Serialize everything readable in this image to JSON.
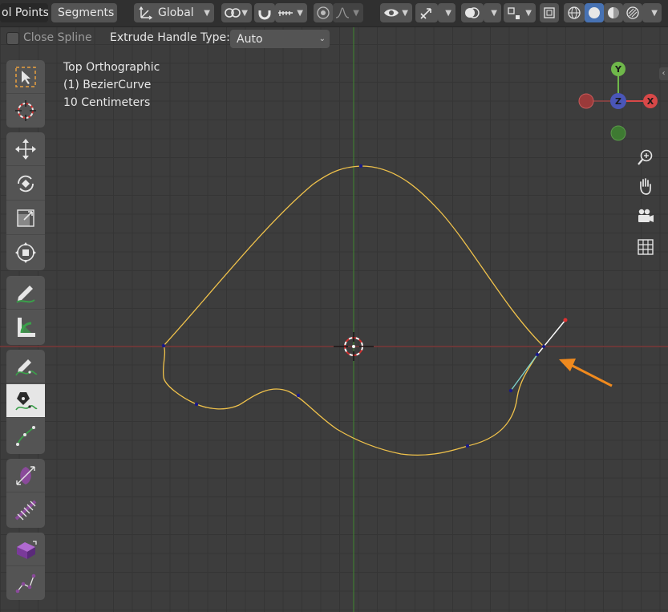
{
  "header": {
    "control_points_label": "ol Points",
    "segments_label": "Segments",
    "orientation_label": "Global"
  },
  "tool_settings": {
    "close_spline_label": "Close Spline",
    "extrude_handle_label": "Extrude Handle Type:",
    "extrude_handle_value": "Auto"
  },
  "viewport": {
    "view_name": "Top Orthographic",
    "object_name": "(1) BezierCurve",
    "scale": "10 Centimeters"
  },
  "gizmo": {
    "y": "Y",
    "z": "Z",
    "x": "X"
  },
  "colors": {
    "curve": "#f0c24b",
    "axis_x": "#8a3a3a",
    "axis_y": "#3f7a32",
    "arrow": "#f08a1e",
    "handle_selected": "#ffffff",
    "handle_auto": "#7fd6cf"
  }
}
